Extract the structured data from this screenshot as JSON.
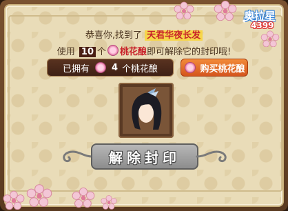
{
  "logo": {
    "name": "奥拉星",
    "number": "4399"
  },
  "message": {
    "congrats_prefix": "恭喜你,找到了",
    "character_name": "天君华夜长发",
    "use_prefix": "使用",
    "required_count": "10",
    "unit": "个",
    "item_name": "桃花酿",
    "use_suffix": "即可解除它的封印哦!"
  },
  "owned": {
    "prefix": "已拥有",
    "count": "4",
    "suffix": "个桃花酿"
  },
  "buy_button": {
    "label": "购买桃花酿"
  },
  "unseal_button": {
    "label": "解除封印"
  },
  "colors": {
    "highlight": "#c8222a",
    "accent_orange": "#e06a28",
    "panel": "#e9dcb8"
  }
}
